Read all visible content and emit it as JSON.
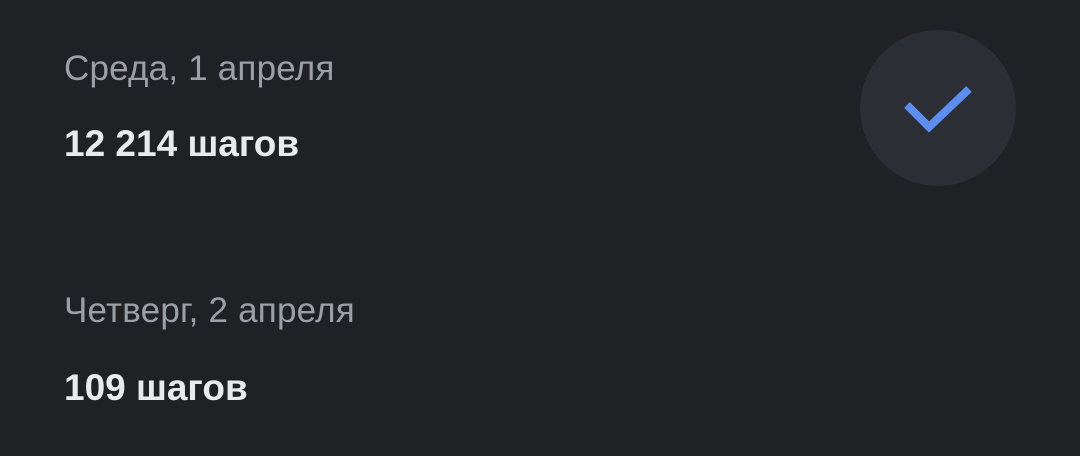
{
  "days": [
    {
      "date": "Среда, 1 апреля",
      "steps": "12 214 шагов",
      "goal_reached": true,
      "icon": "check-icon"
    },
    {
      "date": "Четверг, 2 апреля",
      "steps": "109 шагов",
      "goal_reached": false
    }
  ],
  "colors": {
    "background": "#202124",
    "date_text": "#9aa0a6",
    "steps_text": "#e8eaed",
    "badge_background": "#2b2e34",
    "check_accent": "#5c8ef2"
  }
}
